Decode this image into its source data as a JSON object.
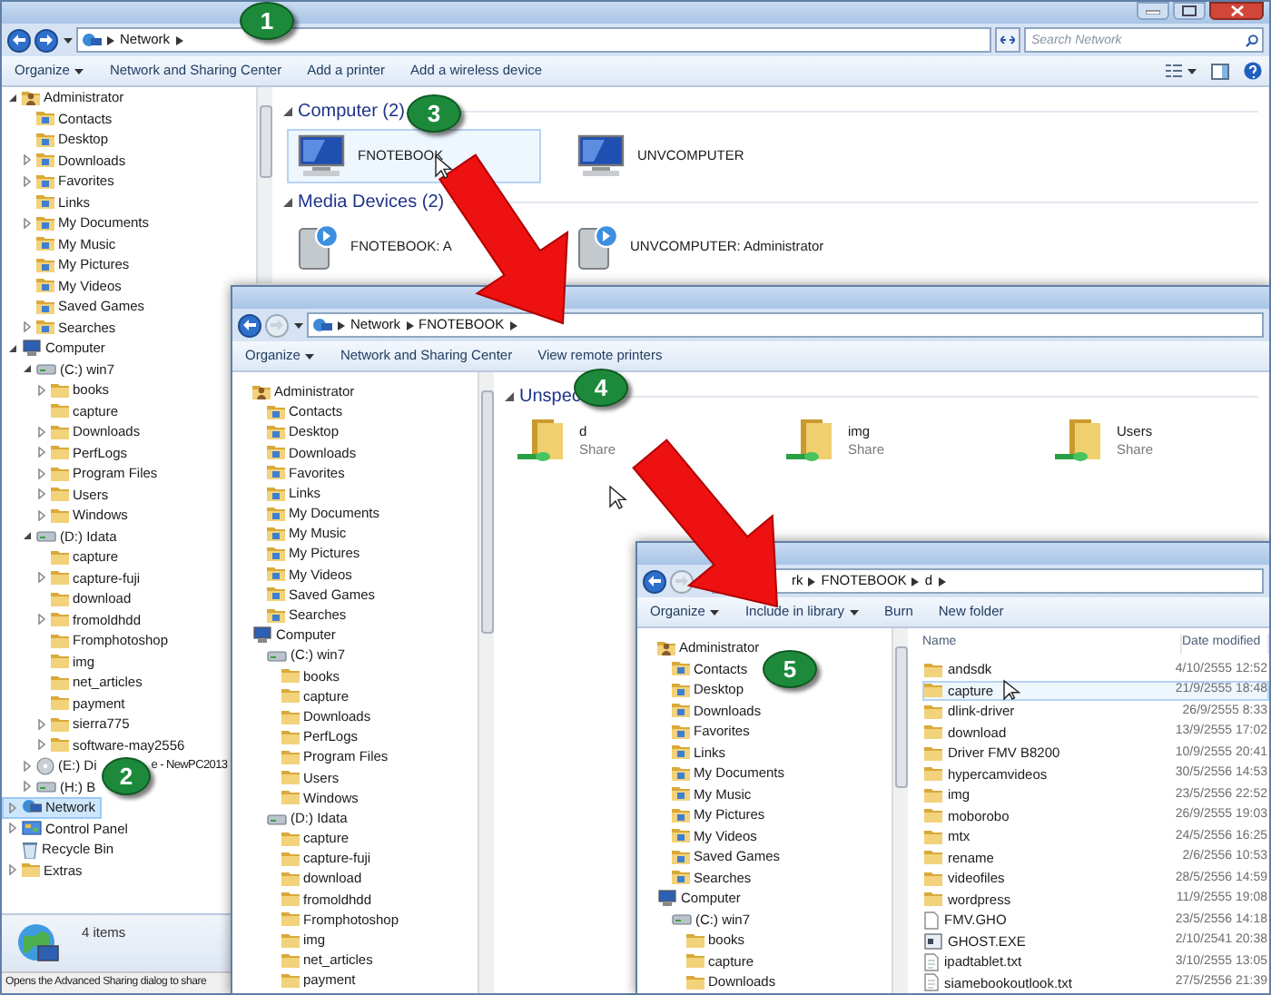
{
  "windows": [
    {
      "address": [
        "Network"
      ],
      "forward_enabled": true,
      "search": {
        "placeholder": "Search Network"
      },
      "toolbar": [
        {
          "label": "Organize",
          "dropdown": true
        },
        {
          "label": "Network and Sharing Center",
          "dropdown": false
        },
        {
          "label": "Add a printer",
          "dropdown": false
        },
        {
          "label": "Add a wireless device",
          "dropdown": false
        }
      ],
      "nav": [
        {
          "label": "Administrator",
          "kind": "user",
          "expanded": true,
          "selected": false,
          "children": [
            {
              "label": "Contacts",
              "kind": "special",
              "selected": false
            },
            {
              "label": "Desktop",
              "kind": "special",
              "selected": false
            },
            {
              "label": "Downloads",
              "kind": "special",
              "expanded": false,
              "selected": false
            },
            {
              "label": "Favorites",
              "kind": "special",
              "expanded": false,
              "selected": false
            },
            {
              "label": "Links",
              "kind": "special",
              "selected": false
            },
            {
              "label": "My Documents",
              "kind": "special",
              "expanded": false,
              "selected": false
            },
            {
              "label": "My Music",
              "kind": "special",
              "selected": false
            },
            {
              "label": "My Pictures",
              "kind": "special",
              "selected": false
            },
            {
              "label": "My Videos",
              "kind": "special",
              "selected": false
            },
            {
              "label": "Saved Games",
              "kind": "special",
              "selected": false
            },
            {
              "label": "Searches",
              "kind": "special",
              "expanded": false,
              "selected": false
            }
          ]
        },
        {
          "label": "Computer",
          "kind": "computer",
          "expanded": true,
          "selected": false,
          "children": [
            {
              "label": "(C:) win7",
              "kind": "drive",
              "expanded": true,
              "selected": false,
              "children": [
                {
                  "label": "books",
                  "kind": "folder",
                  "expanded": false,
                  "selected": false
                },
                {
                  "label": "capture",
                  "kind": "folder",
                  "selected": false
                },
                {
                  "label": "Downloads",
                  "kind": "folder",
                  "expanded": false,
                  "selected": false
                },
                {
                  "label": "PerfLogs",
                  "kind": "folder",
                  "expanded": false,
                  "selected": false
                },
                {
                  "label": "Program Files",
                  "kind": "folder",
                  "expanded": false,
                  "selected": false
                },
                {
                  "label": "Users",
                  "kind": "folder",
                  "expanded": false,
                  "selected": false
                },
                {
                  "label": "Windows",
                  "kind": "folder",
                  "expanded": false,
                  "selected": false
                }
              ]
            },
            {
              "label": "(D:) Idata",
              "kind": "drive",
              "expanded": true,
              "selected": false,
              "children": [
                {
                  "label": "capture",
                  "kind": "folder",
                  "selected": false
                },
                {
                  "label": "capture-fuji",
                  "kind": "folder",
                  "expanded": false,
                  "selected": false
                },
                {
                  "label": "download",
                  "kind": "folder",
                  "selected": false
                },
                {
                  "label": "fromoldhdd",
                  "kind": "folder",
                  "expanded": false,
                  "selected": false
                },
                {
                  "label": "Fromphotoshop",
                  "kind": "folder",
                  "selected": false
                },
                {
                  "label": "img",
                  "kind": "folder",
                  "selected": false
                },
                {
                  "label": "net_articles",
                  "kind": "folder",
                  "selected": false
                },
                {
                  "label": "payment",
                  "kind": "folder",
                  "selected": false
                },
                {
                  "label": "sierra775",
                  "kind": "folder",
                  "expanded": false,
                  "selected": false
                },
                {
                  "label": "software-may2556",
                  "kind": "folder",
                  "expanded": false,
                  "selected": false
                }
              ]
            },
            {
              "label": "(E:) Di",
              "tail": "e - NewPC2013",
              "kind": "disc",
              "expanded": false,
              "selected": false
            },
            {
              "label": "(H:) B",
              "kind": "drive",
              "expanded": false,
              "selected": false
            }
          ]
        },
        {
          "label": "Network",
          "kind": "network",
          "expanded": false,
          "selected": true
        },
        {
          "label": "Control Panel",
          "kind": "panel",
          "expanded": false,
          "selected": false
        },
        {
          "label": "Recycle Bin",
          "kind": "bin",
          "selected": false
        },
        {
          "label": "Extras",
          "kind": "folder",
          "expanded": false,
          "selected": false
        }
      ],
      "groups": [
        {
          "title": "Computer (2)",
          "items": [
            {
              "label": "FNOTEBOOK",
              "kind": "computer",
              "highlighted": true
            },
            {
              "label": "UNVCOMPUTER",
              "kind": "computer",
              "highlighted": false
            }
          ]
        },
        {
          "title": "Media Devices (2)",
          "items": [
            {
              "label": "FNOTEBOOK: A",
              "kind": "media",
              "highlighted": false
            },
            {
              "label": "UNVCOMPUTER: Administrator",
              "kind": "media",
              "highlighted": false
            }
          ]
        }
      ],
      "details": "4 items",
      "status_bar": "Opens the Advanced Sharing dialog to share"
    },
    {
      "address": [
        "Network",
        "FNOTEBOOK"
      ],
      "forward_enabled": false,
      "toolbar": [
        {
          "label": "Organize",
          "dropdown": true
        },
        {
          "label": "Network and Sharing Center",
          "dropdown": false
        },
        {
          "label": "View remote printers",
          "dropdown": false
        }
      ],
      "nav": [
        {
          "label": "Administrator",
          "kind": "user",
          "selected": false,
          "children": [
            {
              "label": "Contacts",
              "kind": "special",
              "selected": false
            },
            {
              "label": "Desktop",
              "kind": "special",
              "selected": false
            },
            {
              "label": "Downloads",
              "kind": "special",
              "selected": false
            },
            {
              "label": "Favorites",
              "kind": "special",
              "selected": false
            },
            {
              "label": "Links",
              "kind": "special",
              "selected": false
            },
            {
              "label": "My Documents",
              "kind": "special",
              "selected": false
            },
            {
              "label": "My Music",
              "kind": "special",
              "selected": false
            },
            {
              "label": "My Pictures",
              "kind": "special",
              "selected": false
            },
            {
              "label": "My Videos",
              "kind": "special",
              "selected": false
            },
            {
              "label": "Saved Games",
              "kind": "special",
              "selected": false
            },
            {
              "label": "Searches",
              "kind": "special",
              "selected": false
            }
          ]
        },
        {
          "label": "Computer",
          "kind": "computer",
          "selected": false,
          "children": [
            {
              "label": "(C:) win7",
              "kind": "drive",
              "selected": false,
              "children": [
                {
                  "label": "books",
                  "kind": "folder",
                  "selected": false
                },
                {
                  "label": "capture",
                  "kind": "folder",
                  "selected": false
                },
                {
                  "label": "Downloads",
                  "kind": "folder",
                  "selected": false
                },
                {
                  "label": "PerfLogs",
                  "kind": "folder",
                  "selected": false
                },
                {
                  "label": "Program Files",
                  "kind": "folder",
                  "selected": false
                },
                {
                  "label": "Users",
                  "kind": "folder",
                  "selected": false
                },
                {
                  "label": "Windows",
                  "kind": "folder",
                  "selected": false
                }
              ]
            },
            {
              "label": "(D:) Idata",
              "kind": "drive",
              "selected": false,
              "children": [
                {
                  "label": "capture",
                  "kind": "folder",
                  "selected": false
                },
                {
                  "label": "capture-fuji",
                  "kind": "folder",
                  "selected": false
                },
                {
                  "label": "download",
                  "kind": "folder",
                  "selected": false
                },
                {
                  "label": "fromoldhdd",
                  "kind": "folder",
                  "selected": false
                },
                {
                  "label": "Fromphotoshop",
                  "kind": "folder",
                  "selected": false
                },
                {
                  "label": "img",
                  "kind": "folder",
                  "selected": false
                },
                {
                  "label": "net_articles",
                  "kind": "folder",
                  "selected": false
                },
                {
                  "label": "payment",
                  "kind": "folder",
                  "selected": false
                }
              ]
            }
          ]
        }
      ],
      "groups": [
        {
          "title": "Unspec",
          "items": [
            {
              "label": "d",
              "sublabel": "Share",
              "kind": "share",
              "highlighted": false
            },
            {
              "label": "img",
              "sublabel": "Share",
              "kind": "share",
              "highlighted": false
            },
            {
              "label": "Users",
              "sublabel": "Share",
              "kind": "share",
              "highlighted": false
            }
          ]
        }
      ]
    },
    {
      "address": [
        "rk",
        "FNOTEBOOK",
        "d"
      ],
      "forward_enabled": false,
      "toolbar": [
        {
          "label": "Organize",
          "dropdown": true
        },
        {
          "label": "Include in library",
          "dropdown": true
        },
        {
          "label": "Burn",
          "dropdown": false
        },
        {
          "label": "New folder",
          "dropdown": false
        }
      ],
      "nav": [
        {
          "label": "Administrator",
          "kind": "user",
          "selected": false,
          "children": [
            {
              "label": "Contacts",
              "kind": "special",
              "selected": false
            },
            {
              "label": "Desktop",
              "kind": "special",
              "selected": false
            },
            {
              "label": "Downloads",
              "kind": "special",
              "selected": false
            },
            {
              "label": "Favorites",
              "kind": "special",
              "selected": false
            },
            {
              "label": "Links",
              "kind": "special",
              "selected": false
            },
            {
              "label": "My Documents",
              "kind": "special",
              "selected": false
            },
            {
              "label": "My Music",
              "kind": "special",
              "selected": false
            },
            {
              "label": "My Pictures",
              "kind": "special",
              "selected": false
            },
            {
              "label": "My Videos",
              "kind": "special",
              "selected": false
            },
            {
              "label": "Saved Games",
              "kind": "special",
              "selected": false
            },
            {
              "label": "Searches",
              "kind": "special",
              "selected": false
            }
          ]
        },
        {
          "label": "Computer",
          "kind": "computer",
          "selected": false,
          "children": [
            {
              "label": "(C:) win7",
              "kind": "drive",
              "selected": false,
              "children": [
                {
                  "label": "books",
                  "kind": "folder",
                  "selected": false
                },
                {
                  "label": "capture",
                  "kind": "folder",
                  "selected": false
                },
                {
                  "label": "Downloads",
                  "kind": "folder",
                  "selected": false
                }
              ]
            }
          ]
        }
      ],
      "files": {
        "columns": [
          "Name",
          "Date modified"
        ],
        "rows": [
          {
            "name": "andsdk",
            "date": "4/10/2555 12:52",
            "kind": "folder",
            "highlighted": false
          },
          {
            "name": "capture",
            "date": "21/9/2555 18:48",
            "kind": "folder",
            "highlighted": true
          },
          {
            "name": "dlink-driver",
            "date": "26/9/2555 8:33",
            "kind": "folder",
            "highlighted": false
          },
          {
            "name": "download",
            "date": "13/9/2555 17:02",
            "kind": "folder",
            "highlighted": false
          },
          {
            "name": "Driver FMV B8200",
            "date": "10/9/2555 20:41",
            "kind": "folder",
            "highlighted": false
          },
          {
            "name": "hypercamvideos",
            "date": "30/5/2556 14:53",
            "kind": "folder",
            "highlighted": false
          },
          {
            "name": "img",
            "date": "23/5/2556 22:52",
            "kind": "folder",
            "highlighted": false
          },
          {
            "name": "moborobo",
            "date": "26/9/2555 19:03",
            "kind": "folder",
            "highlighted": false
          },
          {
            "name": "mtx",
            "date": "24/5/2556 16:25",
            "kind": "folder",
            "highlighted": false
          },
          {
            "name": "rename",
            "date": "2/6/2556 10:53",
            "kind": "folder",
            "highlighted": false
          },
          {
            "name": "videofiles",
            "date": "28/5/2556 14:59",
            "kind": "folder",
            "highlighted": false
          },
          {
            "name": "wordpress",
            "date": "11/9/2555 19:08",
            "kind": "folder",
            "highlighted": false
          },
          {
            "name": "FMV.GHO",
            "date": "23/5/2556 14:18",
            "kind": "file",
            "highlighted": false
          },
          {
            "name": "GHOST.EXE",
            "date": "2/10/2541 20:38",
            "kind": "exe",
            "highlighted": false
          },
          {
            "name": "ipadtablet.txt",
            "date": "3/10/2555 13:05",
            "kind": "text",
            "highlighted": false
          },
          {
            "name": "siamebookoutlook.txt",
            "date": "27/5/2556 21:39",
            "kind": "text",
            "highlighted": false
          }
        ]
      }
    }
  ],
  "callouts": [
    "1",
    "2",
    "3",
    "4",
    "5"
  ]
}
